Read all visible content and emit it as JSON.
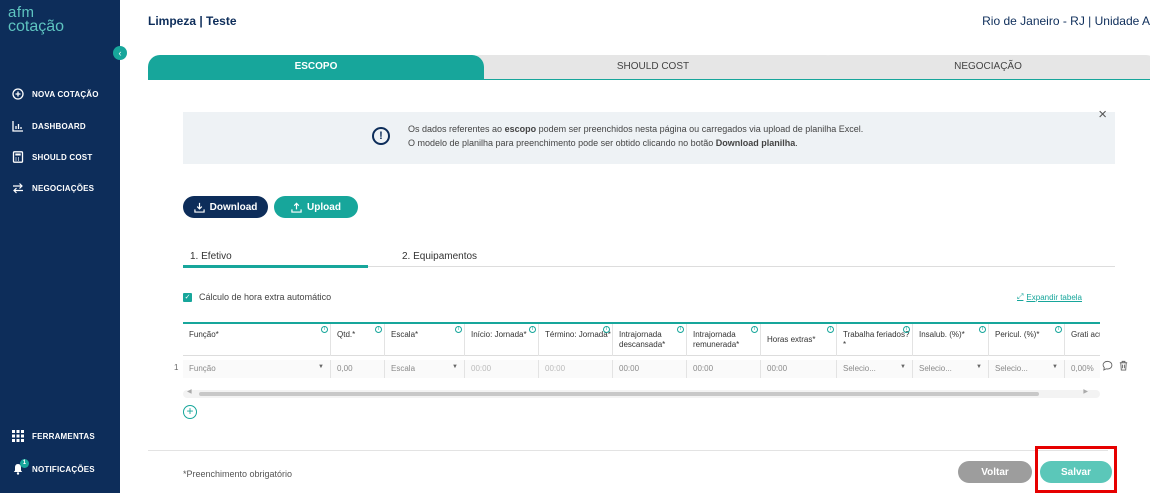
{
  "sidebar": {
    "logo_line1": "afm",
    "logo_line2": "cotação",
    "collapse_icon": "chevron-left-icon",
    "items": [
      {
        "label": "NOVA COTAÇÃO",
        "icon": "plus-circle-icon"
      },
      {
        "label": "DASHBOARD",
        "icon": "chart-icon"
      },
      {
        "label": "SHOULD COST",
        "icon": "calculator-icon"
      },
      {
        "label": "NEGOCIAÇÕES",
        "icon": "arrows-icon"
      }
    ],
    "bottom_items": [
      {
        "label": "FERRAMENTAS",
        "icon": "grid-icon"
      },
      {
        "label": "NOTIFICAÇÕES",
        "icon": "bell-icon",
        "badge": "1"
      }
    ]
  },
  "header": {
    "breadcrumb": "Limpeza | Teste",
    "location": "Rio de Janeiro - RJ | Unidade A"
  },
  "tabs": [
    {
      "label": "ESCOPO",
      "active": true
    },
    {
      "label": "SHOULD COST",
      "active": false
    },
    {
      "label": "NEGOCIAÇÃO",
      "active": false
    }
  ],
  "info": {
    "line1_pre": "Os dados referentes ao ",
    "line1_bold": "escopo",
    "line1_post": " podem ser preenchidos nesta página ou carregados via upload de planilha Excel.",
    "line2_pre": "O modelo de planilha para preenchimento pode ser obtido clicando no botão ",
    "line2_bold": "Download planilha",
    "line2_post": "."
  },
  "actions": {
    "download": "Download",
    "upload": "Upload"
  },
  "subtabs": [
    "1. Efetivo",
    "2. Equipamentos"
  ],
  "checkbox_label": "Cálculo de hora extra automático",
  "expand_label": "Expandir tabela",
  "table": {
    "headers": [
      "Função*",
      "Qtd.*",
      "Escala*",
      "Início: Jornada*",
      "Término: Jornada*",
      "Intrajornada descansada*",
      "Intrajornada remunerada*",
      "Horas extras*",
      "Trabalha feriados?*",
      "Insalub. (%)*",
      "Pericul. (%)*",
      "Grati acúm"
    ],
    "row_number": "1",
    "row": [
      "Função",
      "0,00",
      "Escala",
      "00:00",
      "00:00",
      "00:00",
      "00:00",
      "00:00",
      "Selecio...",
      "Selecio...",
      "Selecio...",
      "0,00%"
    ]
  },
  "footer": {
    "required_note": "*Preenchimento obrigatório",
    "back": "Voltar",
    "save": "Salvar"
  },
  "colors": {
    "sidebar": "#0d2d5a",
    "accent": "#17a69b",
    "highlight": "#e60000"
  }
}
